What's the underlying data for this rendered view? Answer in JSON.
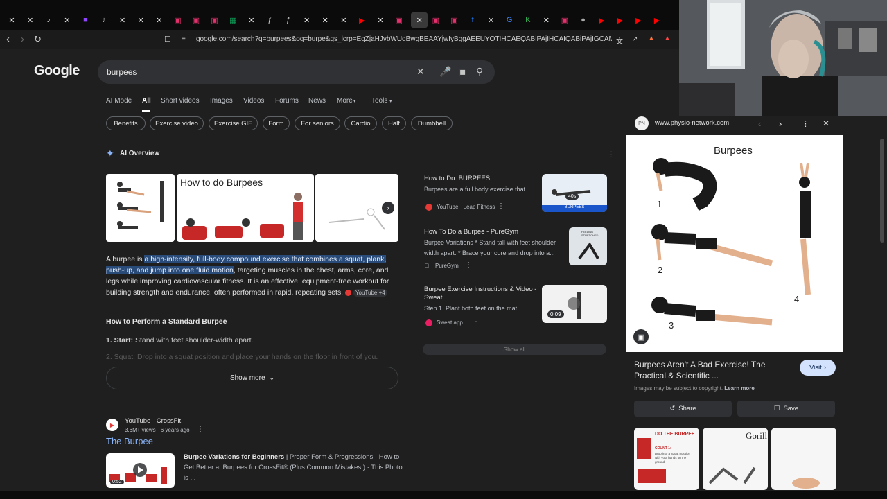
{
  "browser": {
    "url": "google.com/search?q=burpees&oq=burpe&gs_lcrp=EgZjaHJvbWUqBwgBEAAYjwIyBggAEEUYOTIHCAEQABiPAjIHCAIQABiPAjIGCAMQLhhA0gEI...",
    "tabs": [
      "X",
      "X",
      "tiktok",
      "X",
      "twitch",
      "tiktok",
      "X",
      "X",
      "X",
      "instagram",
      "instagram",
      "instagram",
      "sheets",
      "X",
      "feather",
      "feather",
      "X",
      "X",
      "X",
      "youtube",
      "X",
      "instagram",
      "close",
      "instagram",
      "instagram",
      "facebook",
      "X",
      "google",
      "green",
      "X",
      "instagram",
      "chrome",
      "youtube",
      "youtube",
      "youtube",
      "youtube"
    ]
  },
  "google": {
    "logo": "Google",
    "query": "burpees",
    "tabs": [
      "AI Mode",
      "All",
      "Short videos",
      "Images",
      "Videos",
      "Forums",
      "News",
      "More",
      "Tools"
    ],
    "chips": [
      "Benefits",
      "Exercise video",
      "Exercise GIF",
      "Form",
      "For seniors",
      "Cardio",
      "Half",
      "Dumbbell"
    ]
  },
  "ai_overview": {
    "title": "AI Overview",
    "image_caption": "How to do Burpees",
    "text_pre": "A burpee is ",
    "text_highlight": "a high-intensity, full-body compound exercise that combines a squat, plank, push-up, and jump into one fluid motion",
    "text_post": ", targeting muscles in the chest, arms, core, and legs while improving cardiovascular fitness. It is an effective, equipment-free workout for building strength and endurance, often performed in rapid, repeating sets.",
    "cite": "YouTube +4",
    "howto_heading": "How to Perform a Standard Burpee",
    "step1_label": "1. Start:",
    "step1_text": " Stand with feet shoulder-width apart.",
    "step2_text": "2. Squat: Drop into a squat position and place your hands on the floor in front of you.",
    "show_more": "Show more"
  },
  "sources": [
    {
      "title": "How to Do:  BURPEES",
      "snippet": "Burpees are a full body exercise that...",
      "meta": "YouTube · Leap Fitness",
      "duration": "40s",
      "thumb_label": "BURPEES"
    },
    {
      "title": "How To Do a Burpee - PureGym",
      "snippet": "Burpee Variations * Stand tall with feet shoulder width apart. * Brace your core and drop into a...",
      "meta": "PureGym",
      "thumb_label": "FEELING STRETCHED"
    },
    {
      "title": "Burpee Exercise Instructions & Video - Sweat",
      "snippet": "Step 1. Plant both feet on the mat...",
      "meta": "Sweat app",
      "duration": "0:09"
    }
  ],
  "show_all": "Show all",
  "result": {
    "source": "YouTube · CrossFit",
    "meta": "3,6M+ views · 6 years ago",
    "title": "The Burpee",
    "desc_bold": "Burpee Variations for Beginners",
    "desc": " | Proper Form & Progressions · How to Get Better at Burpees for CrossFit® (Plus Common Mistakes!) · This Photo is ...",
    "duration": "0:52"
  },
  "right_panel": {
    "site": "www.physio-network.com",
    "image_title": "Burpees",
    "step_numbers": [
      "1",
      "2",
      "3",
      "4"
    ],
    "title": "Burpees Aren't A Bad Exercise! The Practical & Scientific ...",
    "visit": "Visit",
    "copyright": "Images may be subject to copyright.",
    "learn_more": "Learn more",
    "share": "Share",
    "save": "Save",
    "thumb1_label": "DO THE BURPEE",
    "thumb1_sub": "COUNT 1:",
    "thumb1_text": "Drop into a squat position with your hands on the ground.",
    "thumb2_label": "Gorill"
  }
}
